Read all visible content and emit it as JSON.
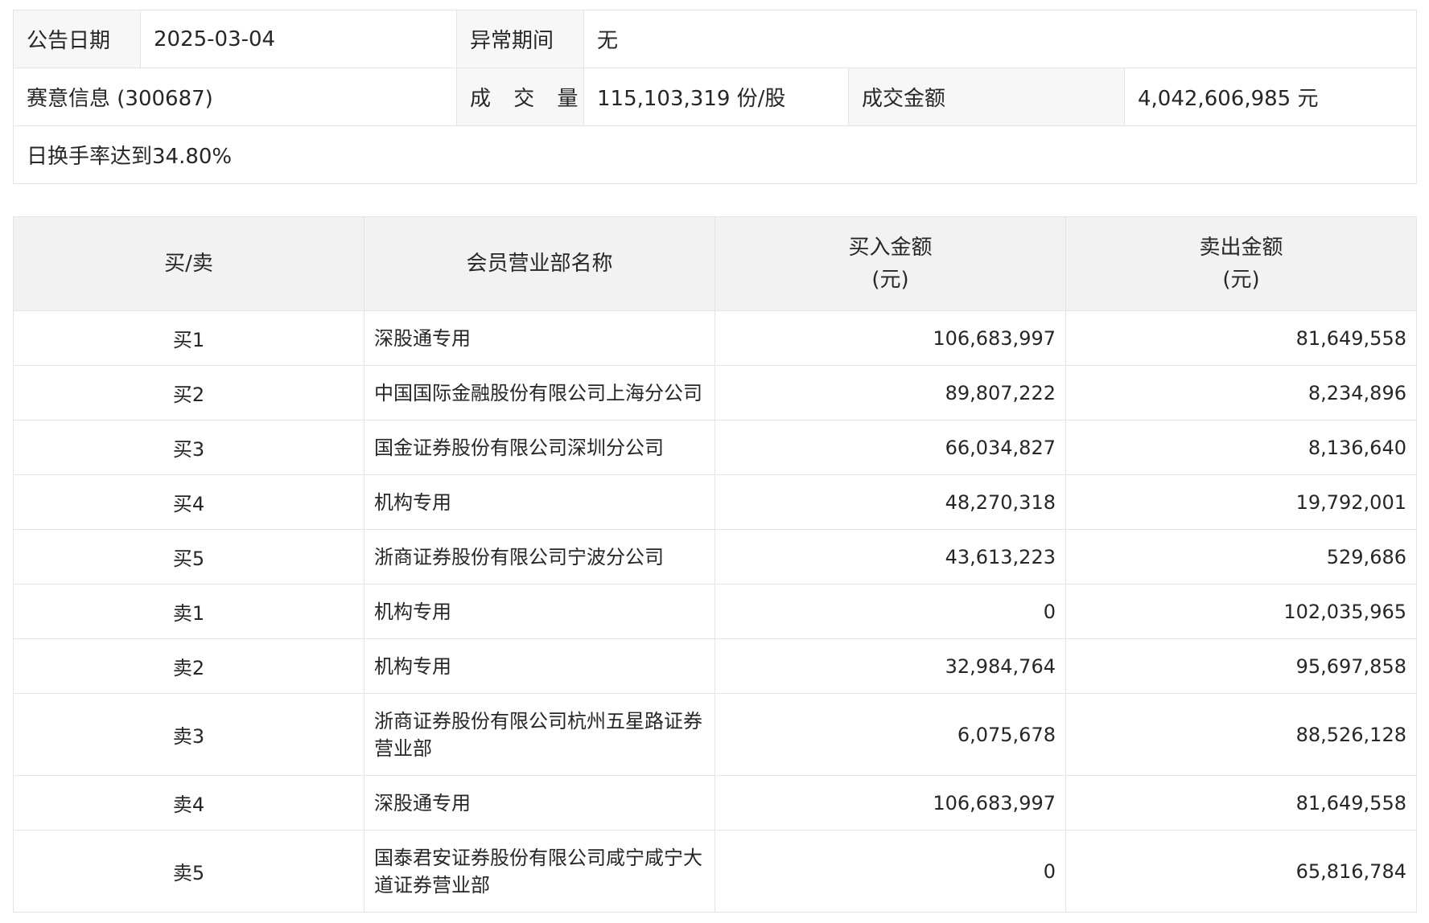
{
  "summary": {
    "announce_date_label": "公告日期",
    "announce_date": "2025-03-04",
    "abnormal_period_label": "异常期间",
    "abnormal_period": "无",
    "stock": "赛意信息 (300687)",
    "volume_label": "成 交 量",
    "volume": "115,103,319 份/股",
    "amount_label": "成交金额",
    "amount": "4,042,606,985 元",
    "reason": "日换手率达到34.80%"
  },
  "trade_table": {
    "headers": {
      "side": "买/卖",
      "dept": "会员营业部名称",
      "buy_line1": "买入金额",
      "buy_line2": "(元)",
      "sell_line1": "卖出金额",
      "sell_line2": "(元)"
    },
    "rows": [
      {
        "side": "买1",
        "dept": "深股通专用",
        "buy": "106,683,997",
        "sell": "81,649,558"
      },
      {
        "side": "买2",
        "dept": "中国国际金融股份有限公司上海分公司",
        "buy": "89,807,222",
        "sell": "8,234,896"
      },
      {
        "side": "买3",
        "dept": "国金证券股份有限公司深圳分公司",
        "buy": "66,034,827",
        "sell": "8,136,640"
      },
      {
        "side": "买4",
        "dept": "机构专用",
        "buy": "48,270,318",
        "sell": "19,792,001"
      },
      {
        "side": "买5",
        "dept": "浙商证券股份有限公司宁波分公司",
        "buy": "43,613,223",
        "sell": "529,686"
      },
      {
        "side": "卖1",
        "dept": "机构专用",
        "buy": "0",
        "sell": "102,035,965"
      },
      {
        "side": "卖2",
        "dept": "机构专用",
        "buy": "32,984,764",
        "sell": "95,697,858"
      },
      {
        "side": "卖3",
        "dept": "浙商证券股份有限公司杭州五星路证券营业部",
        "buy": "6,075,678",
        "sell": "88,526,128"
      },
      {
        "side": "卖4",
        "dept": "深股通专用",
        "buy": "106,683,997",
        "sell": "81,649,558"
      },
      {
        "side": "卖5",
        "dept": "国泰君安证券股份有限公司咸宁咸宁大道证券营业部",
        "buy": "0",
        "sell": "65,816,784"
      }
    ]
  }
}
